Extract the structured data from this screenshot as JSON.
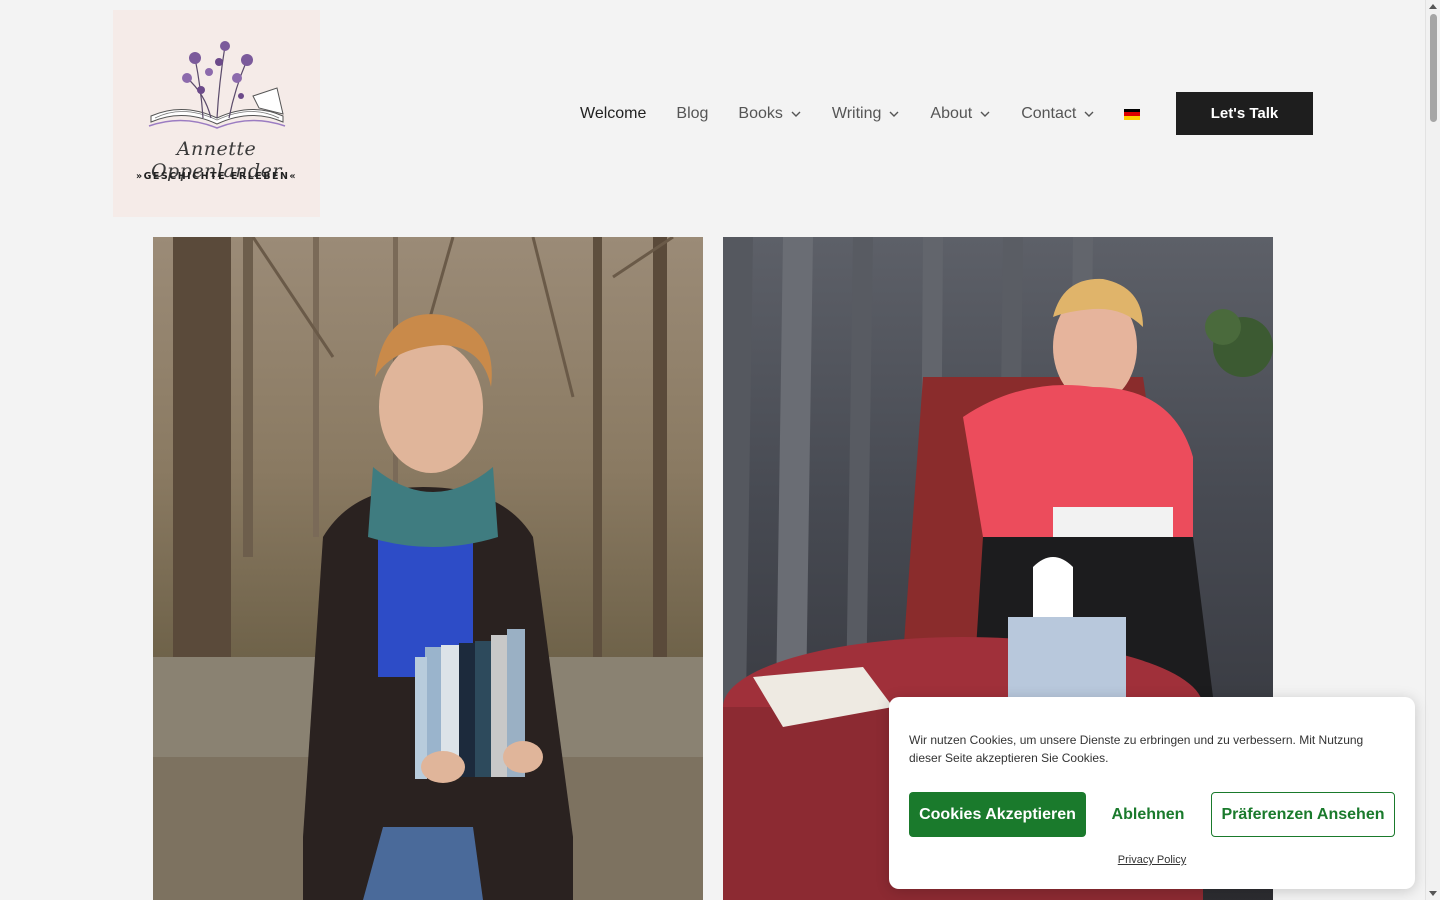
{
  "logo": {
    "script_name": "Annette Oppenlander",
    "tagline": "»GESCHICHTE ERLEBEN«",
    "icon": "open-book-flowers-icon"
  },
  "nav": {
    "items": [
      {
        "label": "Welcome",
        "dropdown": false,
        "active": true
      },
      {
        "label": "Blog",
        "dropdown": false
      },
      {
        "label": "Books",
        "dropdown": true
      },
      {
        "label": "Writing",
        "dropdown": true
      },
      {
        "label": "About",
        "dropdown": true
      },
      {
        "label": "Contact",
        "dropdown": true
      }
    ],
    "language_icon": "german-flag-icon",
    "cta_label": "Let's Talk"
  },
  "photos": [
    {
      "name": "author-holding-books-photo"
    },
    {
      "name": "author-reading-photo"
    }
  ],
  "cookie": {
    "text": "Wir nutzen Cookies, um unsere Dienste zu erbringen und zu verbessern. Mit Nutzung dieser Seite akzeptieren Sie Cookies.",
    "accept_label": "Cookies Akzeptieren",
    "deny_label": "Ablehnen",
    "prefs_label": "Präferenzen Ansehen",
    "privacy_label": "Privacy Policy"
  },
  "colors": {
    "accent_green": "#1a7a2c",
    "cta_bg": "#1e1e1e",
    "page_bg": "#f3f3f3",
    "logo_bg": "#f5ebe8"
  }
}
